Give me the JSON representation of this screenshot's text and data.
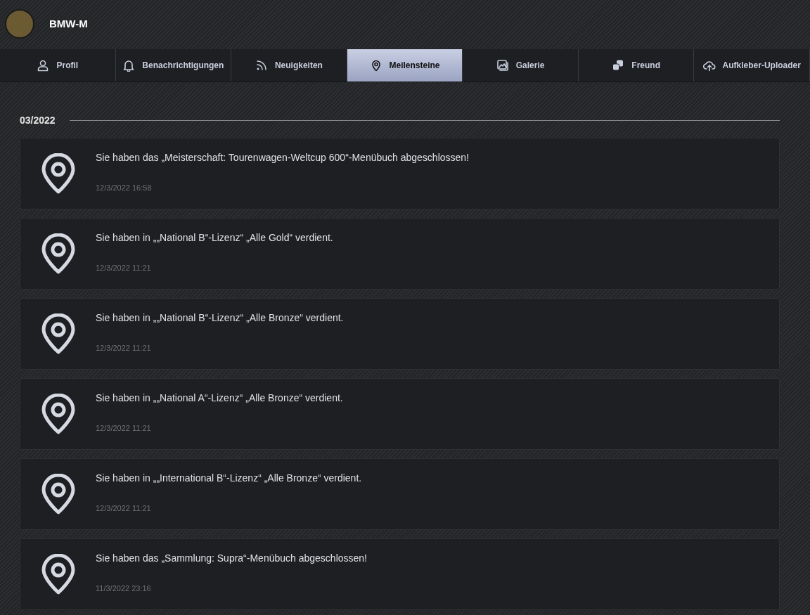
{
  "profile": {
    "name": "BMW-M"
  },
  "tabs": [
    {
      "label": "Profil",
      "kind": "person",
      "selected": false
    },
    {
      "label": "Benachrichtigungen",
      "kind": "bell",
      "selected": false
    },
    {
      "label": "Neuigkeiten",
      "kind": "rss",
      "selected": false
    },
    {
      "label": "Meilensteine",
      "kind": "pin",
      "selected": true
    },
    {
      "label": "Galerie",
      "kind": "gallery",
      "selected": false
    },
    {
      "label": "Freund",
      "kind": "friends",
      "selected": false
    },
    {
      "label": "Aufkleber-Uploader",
      "kind": "upload",
      "selected": false
    }
  ],
  "groups": [
    {
      "month": "03/2022",
      "items": [
        {
          "text": "Sie haben das „Meisterschaft: Tourenwagen-Weltcup 600“-Menübuch abgeschlossen!",
          "time": "12/3/2022 16:58"
        },
        {
          "text": "Sie haben in „„National B“-Lizenz“ „Alle Gold“ verdient.",
          "time": "12/3/2022 11:21"
        },
        {
          "text": "Sie haben in „„National B“-Lizenz“ „Alle Bronze“ verdient.",
          "time": "12/3/2022 11:21"
        },
        {
          "text": "Sie haben in „„National A“-Lizenz“ „Alle Bronze“ verdient.",
          "time": "12/3/2022 11:21"
        },
        {
          "text": "Sie haben in „„International B“-Lizenz“ „Alle Bronze“ verdient.",
          "time": "12/3/2022 11:21"
        },
        {
          "text": "Sie haben das „Sammlung: Supra“-Menübuch abgeschlossen!",
          "time": "11/3/2022 23:16"
        }
      ]
    }
  ]
}
